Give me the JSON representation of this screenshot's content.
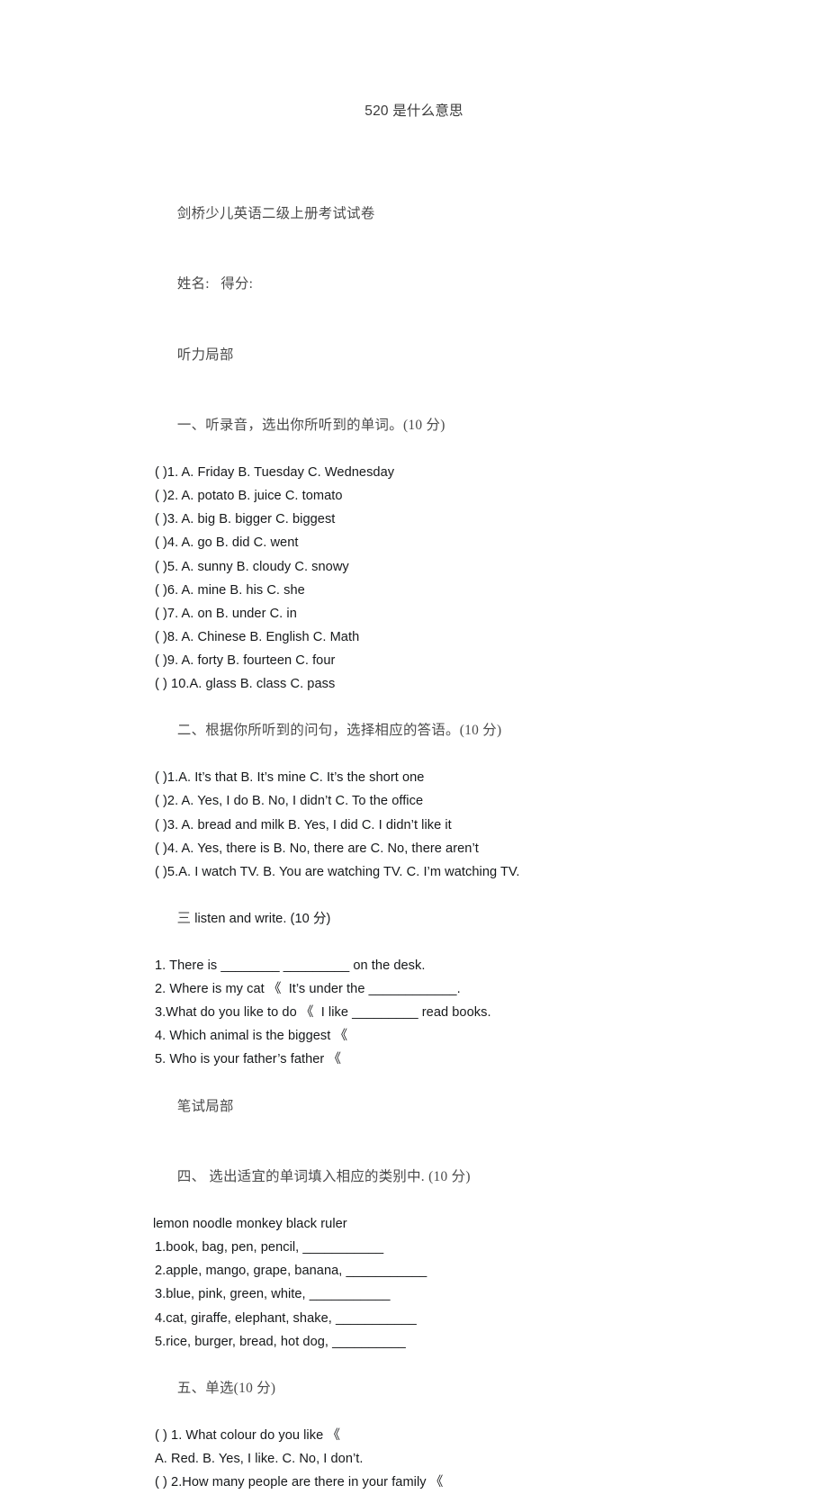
{
  "page": {
    "title": "520 是什么意思",
    "background_color": "#ffffff",
    "text_color": "#16181a",
    "heading_color": "#4a4a4a"
  },
  "document": {
    "exam_title": "剑桥少儿英语二级上册考试试卷",
    "student_fields": "姓名:   得分:",
    "sections": [
      {
        "id": "listening-part",
        "heading": "听力局部",
        "type": "part-heading"
      },
      {
        "id": "section-one",
        "heading": "一、听录音，选出你所听到的单词。(10 分)",
        "items": [
          "( )1. A. Friday B. Tuesday C. Wednesday",
          "( )2. A. potato B. juice C. tomato",
          "( )3. A. big B. bigger C. biggest",
          "( )4. A. go B. did C. went",
          "( )5. A. sunny B. cloudy C. snowy",
          "( )6. A. mine B. his C. she",
          "( )7. A. on B. under C. in",
          "( )8. A. Chinese B. English C. Math",
          "( )9. A. forty B. fourteen C. four",
          "( ) 10.A. glass B. class C. pass"
        ]
      },
      {
        "id": "section-two",
        "heading": "二、根据你所听到的问句，选择相应的答语。(10 分)",
        "items": [
          "( )1.A. It’s that B. It’s mine C. It’s the short one",
          "( )2. A. Yes, I do B. No, I didn’t C. To the office",
          "( )3. A. bread and milk B. Yes, I did C. I didn’t like it",
          "( )4. A. Yes, there is B. No, there are C. No, there aren’t",
          "( )5.A. I watch TV. B. You are watching TV. C. I’m watching TV."
        ]
      },
      {
        "id": "section-three",
        "heading_cn": "三",
        "heading_en": "listen and write. (10 分)",
        "items": [
          "1. There is ________ _________ on the desk.",
          "2. Where is my cat 《  It’s under the ____________.",
          "3.What do you like to do 《  I like _________ read books.",
          "4. Which animal is the biggest 《",
          "5. Who is your father’s father 《"
        ]
      },
      {
        "id": "written-part",
        "heading": "笔试局部",
        "type": "part-heading"
      },
      {
        "id": "section-four",
        "heading": "四、 选出适宜的单词填入相应的类别中. (10 分)",
        "word_bank": "lemon noodle monkey black ruler",
        "items": [
          "1.book, bag, pen, pencil, ___________",
          "2.apple, mango, grape, banana, ___________",
          "3.blue, pink, green, white, ___________",
          "4.cat, giraffe, elephant, shake, ___________",
          "5.rice, burger, bread, hot dog, __________"
        ]
      },
      {
        "id": "section-five",
        "heading": "五、单选(10 分)",
        "items": [
          "( ) 1. What colour do you like 《",
          "A. Red. B. Yes, I like. C. No, I don’t.",
          "( ) 2.How many people are there in your family 《"
        ]
      }
    ]
  }
}
